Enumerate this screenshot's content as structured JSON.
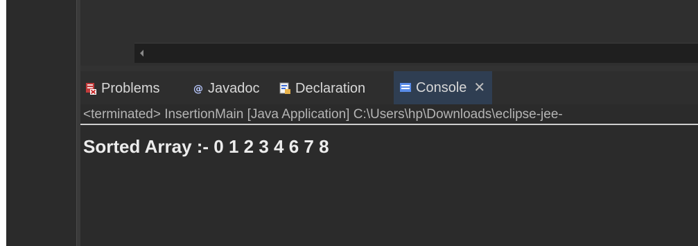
{
  "tabs": [
    {
      "label": "Problems",
      "icon": "problems-icon",
      "active": false
    },
    {
      "label": "Javadoc",
      "icon": "javadoc-icon",
      "active": false
    },
    {
      "label": "Declaration",
      "icon": "declaration-icon",
      "active": false
    },
    {
      "label": "Console",
      "icon": "console-icon",
      "active": true
    }
  ],
  "console": {
    "status": "<terminated> InsertionMain [Java Application] C:\\Users\\hp\\Downloads\\eclipse-jee-",
    "output": "Sorted Array :- 0 1 2 3 4 6 7 8"
  },
  "colors": {
    "background": "#2b2b2b",
    "active_tab": "#2f3e52",
    "text": "#d8d8d8",
    "status_text": "#b5b5b5"
  }
}
